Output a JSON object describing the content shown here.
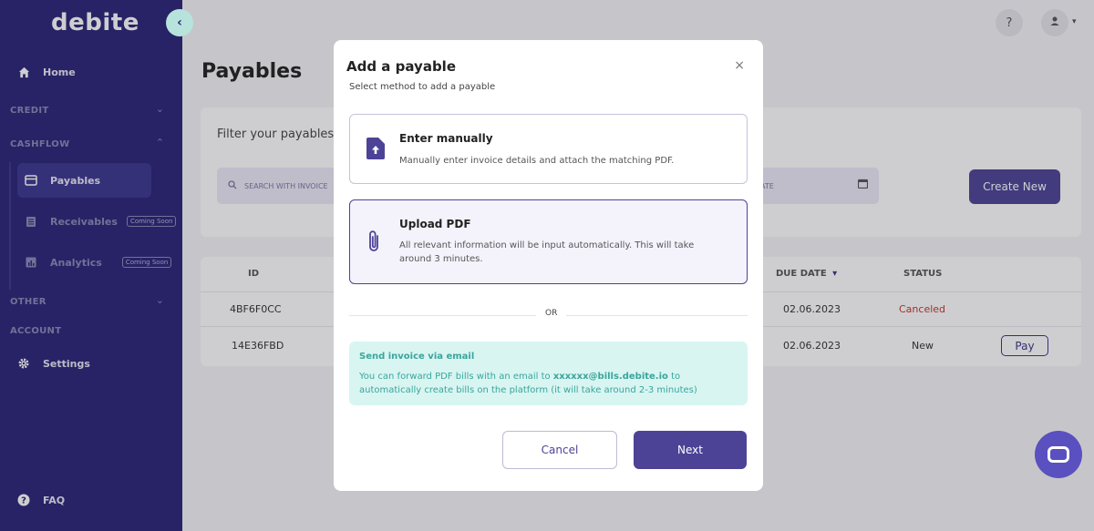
{
  "app": {
    "logo": "debite",
    "collapse_icon": "chevron-left-icon"
  },
  "sidebar": {
    "home": "Home",
    "sections": {
      "credit": "CREDIT",
      "cashflow": "CASHFLOW",
      "other": "OTHER",
      "account": "ACCOUNT"
    },
    "payables": "Payables",
    "receivables": "Receivables",
    "analytics": "Analytics",
    "coming_soon": "Coming Soon",
    "settings": "Settings",
    "faq": "FAQ"
  },
  "topbar": {
    "help": "?",
    "avatar_icon": "user-icon"
  },
  "page": {
    "title": "Payables",
    "filter_label": "Filter your payables b",
    "search_placeholder": "SEARCH WITH INVOICE",
    "date_placeholder": "ATE",
    "create_button": "Create New"
  },
  "table": {
    "headers": {
      "id": "ID",
      "due_date": "DUE DATE",
      "status": "STATUS"
    },
    "rows": [
      {
        "id": "4BF6F0CC",
        "due_date": "02.06.2023",
        "status": "Canceled"
      },
      {
        "id": "14E36FBD",
        "due_date": "02.06.2023",
        "status": "New",
        "action": "Pay"
      }
    ]
  },
  "modal": {
    "title": "Add a payable",
    "subtitle": "Select method to add a payable",
    "close": "×",
    "options": [
      {
        "title": "Enter manually",
        "desc": "Manually enter invoice details and attach the matching PDF.",
        "icon": "file-upload-icon"
      },
      {
        "title": "Upload PDF",
        "desc": "All relevant information will be input automatically. This will take around 3 minutes.",
        "icon": "paperclip-icon"
      }
    ],
    "or": "OR",
    "email": {
      "title": "Send invoice via email",
      "desc_pre": "You can forward PDF bills with an email to ",
      "address": "xxxxxx@bills.debite.io",
      "desc_post": " to automatically create bills on the platform (it will take around 2-3 minutes)"
    },
    "cancel": "Cancel",
    "next": "Next"
  },
  "colors": {
    "sidebar": "#2a2478",
    "accent": "#4c4396",
    "email_bg": "#d8f5f2",
    "email_text": "#3aa59b",
    "canceled": "#c0392b"
  }
}
